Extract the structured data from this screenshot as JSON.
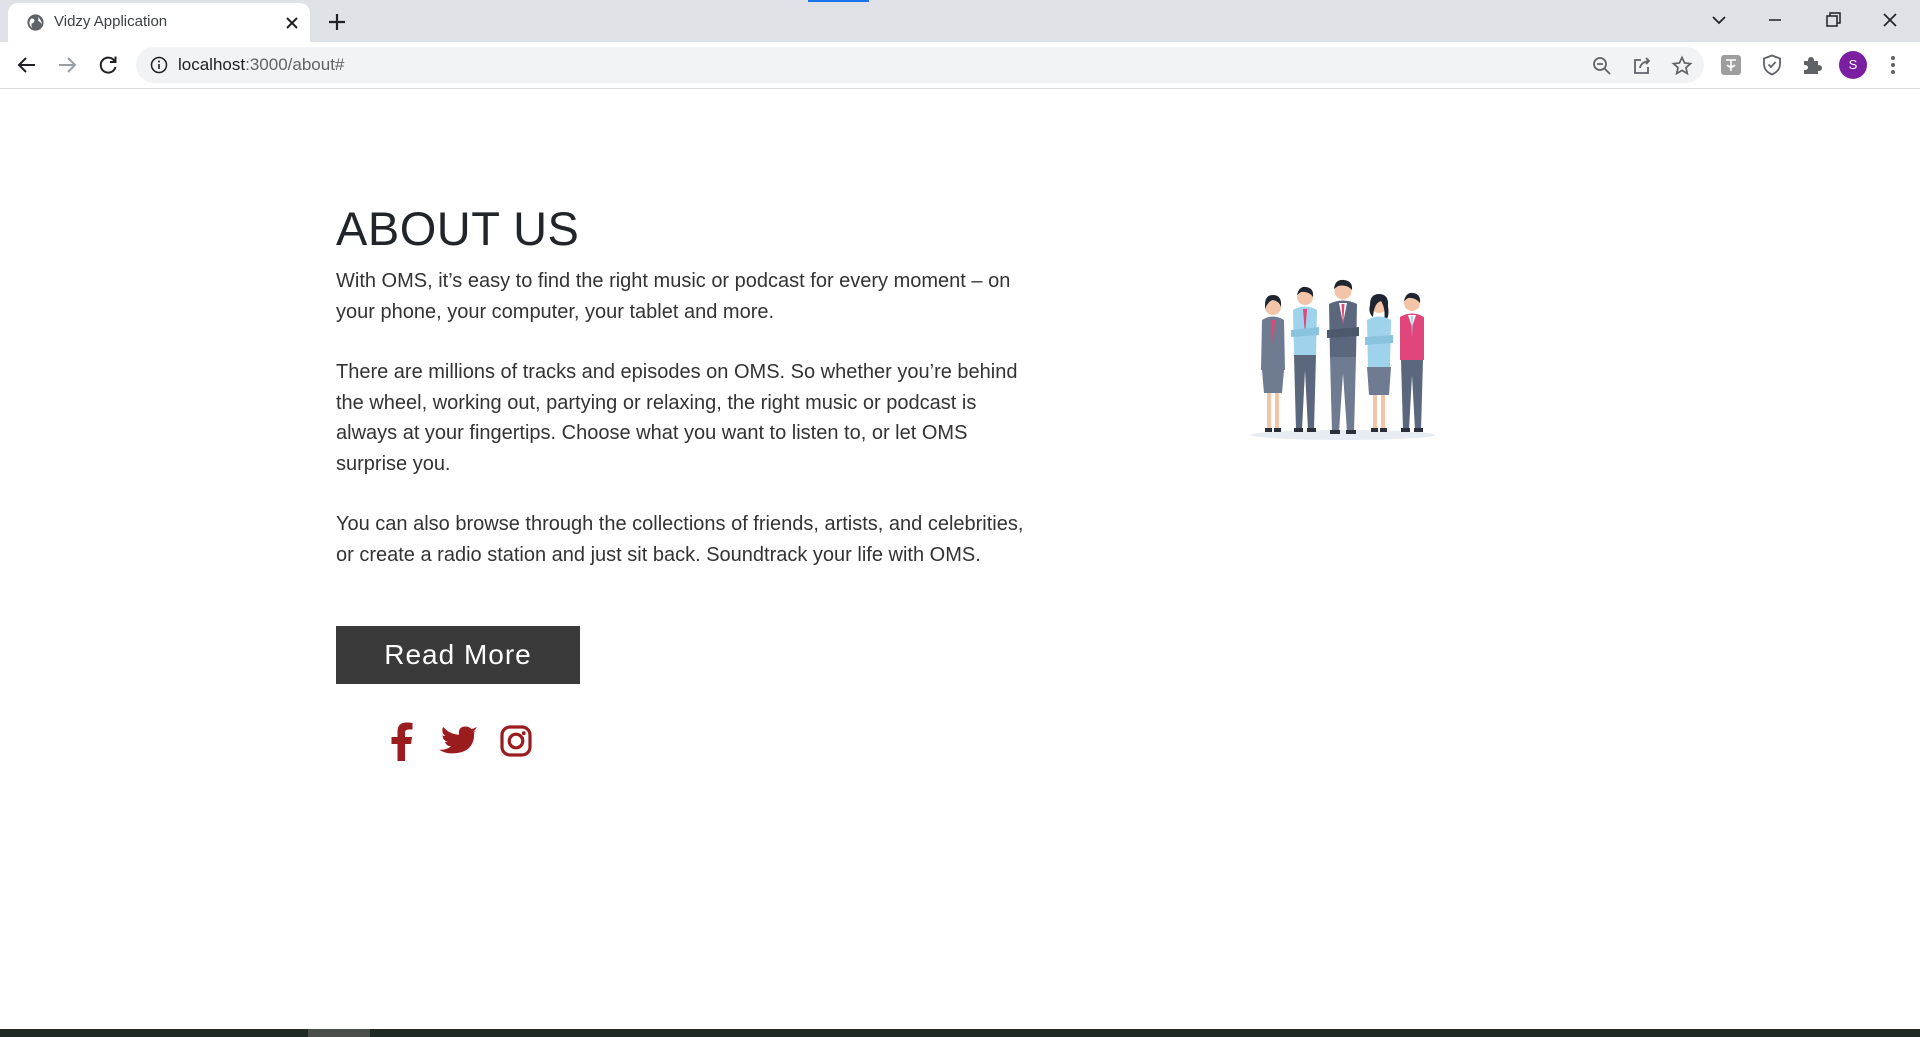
{
  "browser": {
    "tab_title": "Vidzy Application",
    "url_host": "localhost",
    "url_path": ":3000/about#",
    "profile_initial": "S",
    "accent_color": "#1a73e8",
    "avatar_color": "#7b1fa2"
  },
  "about": {
    "heading": "ABOUT US",
    "paragraphs": [
      "With OMS, it’s easy to find the right music or podcast for every moment – on your phone, your computer, your tablet and more.",
      "There are millions of tracks and episodes on OMS. So whether you’re behind the wheel, working out, partying or relaxing, the right music or podcast is always at your fingertips. Choose what you want to listen to, or let OMS surprise you.",
      "You can also browse through the collections of friends, artists, and celebrities, or create a radio station and just sit back. Soundtrack your life with OMS."
    ],
    "button_label": "Read More",
    "button_color": "#3a3a3a",
    "social_color": "#9b1c1f",
    "social_icons": [
      "facebook-icon",
      "twitter-icon",
      "instagram-icon"
    ]
  }
}
